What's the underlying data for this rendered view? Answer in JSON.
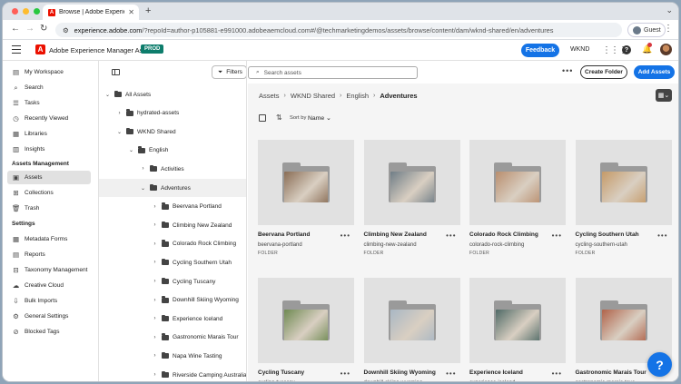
{
  "browser": {
    "tab_title": "Browse | Adobe Experience M",
    "favicon_letter": "A",
    "url_host": "experience.adobe.com",
    "url_path": "/?repoId=author-p105881-e991000.adobeaemcloud.com#/@techmarketingdemos/assets/browse/content/dam/wknd-shared/en/adventures",
    "guest_label": "Guest",
    "traffic_lights": [
      "#ff5f57",
      "#febc2e",
      "#28c840"
    ]
  },
  "shell": {
    "app_name": "Adobe Experience Manager Assets",
    "env_badge": "PROD",
    "feedback_label": "Feedback",
    "org_name": "WKND",
    "notification_count": "1",
    "accent": "#1473e6",
    "brand": "#eb1000"
  },
  "sidebar": {
    "items": [
      {
        "label": "My Workspace",
        "icon": "workspace-icon"
      },
      {
        "label": "Search",
        "icon": "search-icon"
      },
      {
        "label": "Tasks",
        "icon": "tasks-icon"
      },
      {
        "label": "Recently Viewed",
        "icon": "clock-icon"
      },
      {
        "label": "Libraries",
        "icon": "library-icon"
      },
      {
        "label": "Insights",
        "icon": "chart-icon"
      }
    ],
    "section_assets": "Assets Management",
    "assets_items": [
      {
        "label": "Assets",
        "icon": "image-icon",
        "selected": true
      },
      {
        "label": "Collections",
        "icon": "collection-icon"
      },
      {
        "label": "Trash",
        "icon": "trash-icon"
      }
    ],
    "section_settings": "Settings",
    "settings_items": [
      {
        "label": "Metadata Forms",
        "icon": "form-icon"
      },
      {
        "label": "Reports",
        "icon": "report-icon"
      },
      {
        "label": "Taxonomy Management",
        "icon": "taxonomy-icon"
      },
      {
        "label": "Creative Cloud",
        "icon": "creative-cloud-icon"
      },
      {
        "label": "Bulk Imports",
        "icon": "import-icon"
      },
      {
        "label": "General Settings",
        "icon": "gear-icon"
      },
      {
        "label": "Blocked Tags",
        "icon": "tag-icon"
      }
    ]
  },
  "tree": {
    "filters_label": "Filters",
    "nodes": [
      {
        "label": "All Assets",
        "level": 0,
        "expanded": true
      },
      {
        "label": "hydrated-assets",
        "level": 1,
        "expanded": false
      },
      {
        "label": "WKND Shared",
        "level": 1,
        "expanded": true
      },
      {
        "label": "English",
        "level": 2,
        "expanded": true
      },
      {
        "label": "Activities",
        "level": 3,
        "expanded": false
      },
      {
        "label": "Adventures",
        "level": 3,
        "expanded": true,
        "selected": true
      },
      {
        "label": "Beervana Portland",
        "level": 4,
        "expanded": false
      },
      {
        "label": "Climbing New Zealand",
        "level": 4,
        "expanded": false
      },
      {
        "label": "Colorado Rock Climbing",
        "level": 4,
        "expanded": false
      },
      {
        "label": "Cycling Southern Utah",
        "level": 4,
        "expanded": false
      },
      {
        "label": "Cycling Tuscany",
        "level": 4,
        "expanded": false
      },
      {
        "label": "Downhill Skiing Wyoming",
        "level": 4,
        "expanded": false
      },
      {
        "label": "Experience Iceland",
        "level": 4,
        "expanded": false
      },
      {
        "label": "Gastronomic Marais Tour",
        "level": 4,
        "expanded": false
      },
      {
        "label": "Napa Wine Tasting",
        "level": 4,
        "expanded": false
      },
      {
        "label": "Riverside Camping Australia",
        "level": 4,
        "expanded": false
      }
    ]
  },
  "main": {
    "search_placeholder": "Search assets",
    "create_folder_label": "Create Folder",
    "add_assets_label": "Add Assets",
    "breadcrumb": [
      "Assets",
      "WKND Shared",
      "English",
      "Adventures"
    ],
    "sort_by_label": "Sort by",
    "sort_value": "Name",
    "cards": [
      {
        "name": "Beervana Portland",
        "slug": "beervana-portland",
        "type": "FOLDER",
        "tint": "#8a6d55"
      },
      {
        "name": "Climbing New Zealand",
        "slug": "climbing-new-zealand",
        "type": "FOLDER",
        "tint": "#6f7d86"
      },
      {
        "name": "Colorado Rock Climbing",
        "slug": "colorado-rock-climbing",
        "type": "FOLDER",
        "tint": "#b98e6e"
      },
      {
        "name": "Cycling Southern Utah",
        "slug": "cycling-southern-utah",
        "type": "FOLDER",
        "tint": "#c59a68"
      },
      {
        "name": "Cycling Tuscany",
        "slug": "cycling-tuscany",
        "type": "FOLDER",
        "tint": "#6f8a52"
      },
      {
        "name": "Downhill Skiing Wyoming",
        "slug": "downhill-skiing-wyoming",
        "type": "FOLDER",
        "tint": "#a9b7c4"
      },
      {
        "name": "Experience Iceland",
        "slug": "experience-iceland",
        "type": "FOLDER",
        "tint": "#4f6a66"
      },
      {
        "name": "Gastronomic Marais Tour",
        "slug": "gastronomic-marais-tour",
        "type": "FOLDER",
        "tint": "#b0634a"
      }
    ]
  }
}
